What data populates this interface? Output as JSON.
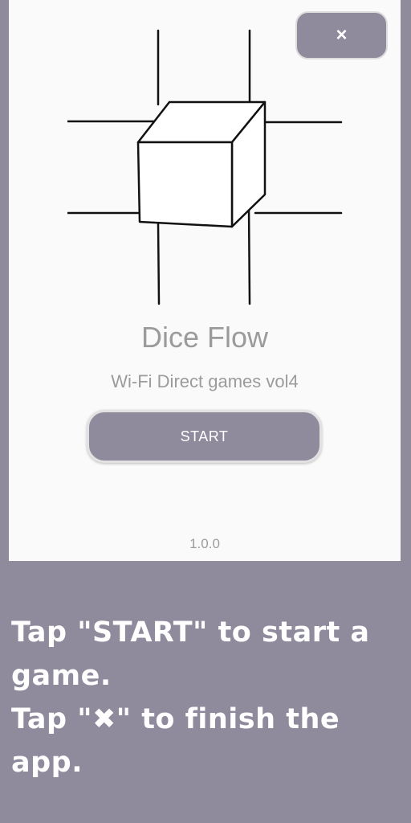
{
  "app": {
    "title": "Dice Flow",
    "subtitle": "Wi-Fi Direct games vol4",
    "version": "1.0.0"
  },
  "buttons": {
    "close_label": "×",
    "start_label": "START"
  },
  "logo": {
    "icon": "dice-grid-icon"
  },
  "instructions": {
    "line1": "Tap \"START\" to start a game.",
    "line2": "Tap \"✖\" to finish the app."
  },
  "colors": {
    "accent": "#8f8a9c",
    "panel": "#fafafa",
    "muted_text": "#9b9b9b"
  }
}
